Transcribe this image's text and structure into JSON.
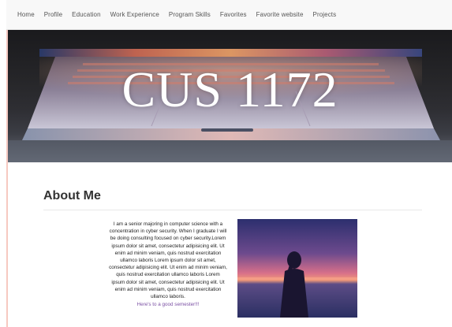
{
  "nav": {
    "items": [
      {
        "label": "Home"
      },
      {
        "label": "Profile"
      },
      {
        "label": "Education"
      },
      {
        "label": "Work Experience"
      },
      {
        "label": "Program Skills"
      },
      {
        "label": "Favorites"
      },
      {
        "label": "Favorite website"
      },
      {
        "label": "Projects"
      }
    ]
  },
  "hero": {
    "title": "CUS 1172",
    "image_icon": "laptop-image"
  },
  "about": {
    "heading": "About Me",
    "text": "I am a senior majoring in computer science with a concentration in cyber security. When I graduate I will be doing consulting focused on cyber security.Lorem ipsum dolor sit amet, consectetur adipisicing elit. Ut enim ad minim veniam, quis nostrud exercitation ullamco laboris Lorem ipsum dolor sit amet, consectetur adipisicing elit. Ut enim ad minim veniam, quis nostrud exercitation ullamco laboris Lorem ipsum dolor sit amet, consectetur adipisicing elit. Ut enim ad minim veniam, quis nostrud exercitation ullamco laboris.",
    "link_text": "Here's to a good semester!!!",
    "photo_icon": "silhouette-sunset-image"
  },
  "colors": {
    "nav_bg": "#f8f8f8",
    "link": "#7a4fa3",
    "frame_border": "#f6c9c1"
  }
}
